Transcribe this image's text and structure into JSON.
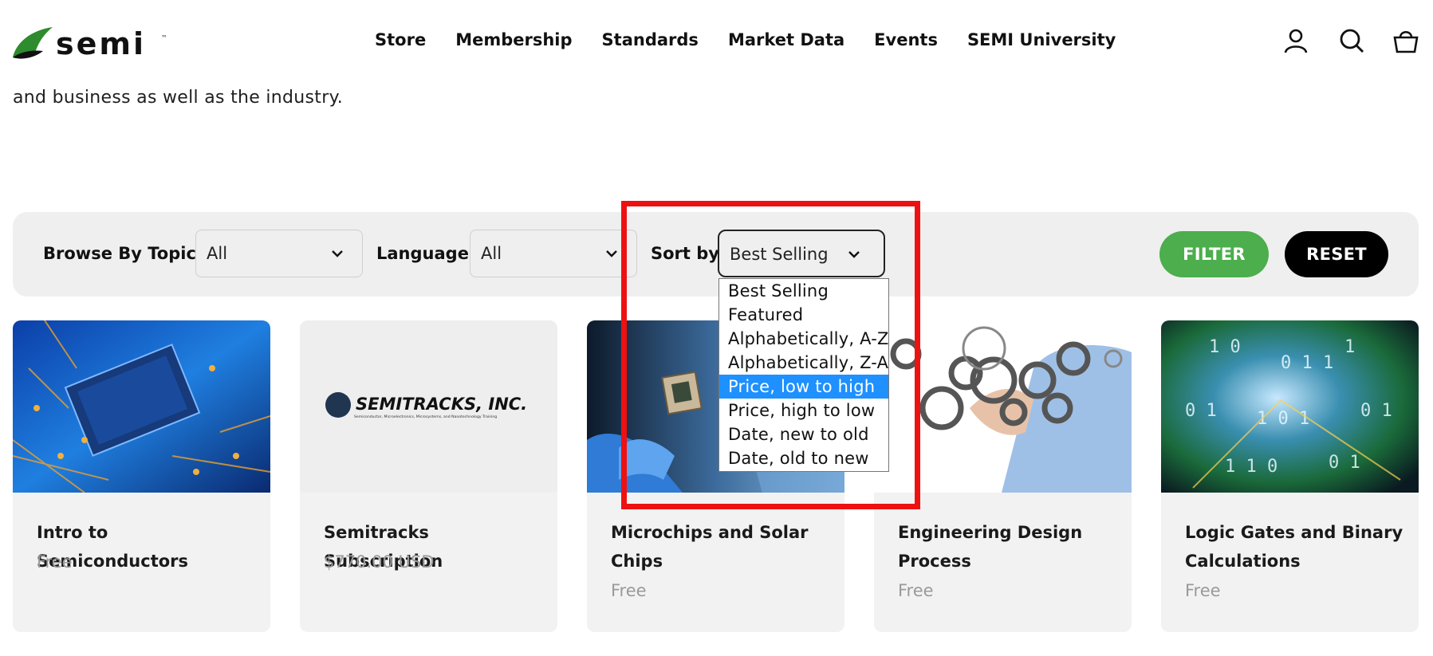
{
  "brand": {
    "name": "semi",
    "logo_color": "#2e8b2e"
  },
  "nav": {
    "items": [
      {
        "label": "Store"
      },
      {
        "label": "Membership"
      },
      {
        "label": "Standards"
      },
      {
        "label": "Market Data"
      },
      {
        "label": "Events"
      },
      {
        "label": "SEMI University"
      }
    ]
  },
  "header_icons": [
    "account-icon",
    "search-icon",
    "cart-icon"
  ],
  "intro_text": "and business as well as the industry.",
  "filters": {
    "topic_label": "Browse By Topic:",
    "topic_value": "All",
    "language_label": "Language:",
    "language_value": "All",
    "sort_label": "Sort by",
    "sort_value": "Best Selling",
    "filter_button": "FILTER",
    "reset_button": "RESET",
    "filter_button_color": "#4cae4c",
    "reset_button_color": "#000000"
  },
  "sort_options": [
    {
      "label": "Best Selling",
      "selected": false
    },
    {
      "label": "Featured",
      "selected": false
    },
    {
      "label": "Alphabetically, A-Z",
      "selected": false
    },
    {
      "label": "Alphabetically, Z-A",
      "selected": false
    },
    {
      "label": "Price, low to high",
      "selected": true
    },
    {
      "label": "Price, high to low",
      "selected": false
    },
    {
      "label": "Date, new to old",
      "selected": false
    },
    {
      "label": "Date, old to new",
      "selected": false
    }
  ],
  "highlight_color": "#ee1111",
  "products": [
    {
      "title": "Intro to Semiconductors",
      "price": "Free"
    },
    {
      "title": "Semitracks Subscription",
      "price": "$770.00 USD",
      "image_text": "SEMITRACKS, INC.",
      "image_subtext": "Semiconductor, Microelectronics, Microsystems, and Nanotechnology Training"
    },
    {
      "title": "Microchips and Solar Chips",
      "price": "Free"
    },
    {
      "title": "Engineering Design Process",
      "price": "Free"
    },
    {
      "title": "Logic Gates and Binary Calculations",
      "price": "Free"
    }
  ]
}
